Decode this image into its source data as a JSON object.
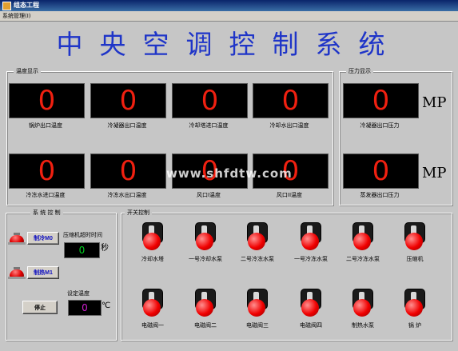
{
  "window": {
    "title": "组态工程"
  },
  "menu": {
    "items": [
      "系统管理(I)"
    ]
  },
  "main_title": "中央空调控制系统",
  "temperature_panel": {
    "title": "温度显示",
    "displays": [
      {
        "value": "0",
        "label": "锅炉出口温度"
      },
      {
        "value": "0",
        "label": "冷凝器出口温度"
      },
      {
        "value": "0",
        "label": "冷却塔进口温度"
      },
      {
        "value": "0",
        "label": "冷却水出口温度"
      },
      {
        "value": "0",
        "label": "冷冻水进口温度"
      },
      {
        "value": "0",
        "label": "冷冻水出口温度"
      },
      {
        "value": "0",
        "label": "风口I温度"
      },
      {
        "value": "0",
        "label": "风口II温度"
      }
    ]
  },
  "pressure_panel": {
    "title": "压力显示",
    "displays": [
      {
        "value": "0",
        "label": "冷凝器出口压力",
        "unit": "MP"
      },
      {
        "value": "0",
        "label": "蒸发器出口压力",
        "unit": "MP"
      }
    ]
  },
  "system_control": {
    "title": "系 统 控 制",
    "cool_button": "制冷M0",
    "heat_button": "制热M1",
    "stop_button": "停止",
    "timeout_label": "压缩机超时时间",
    "timeout_value": "0",
    "timeout_unit": "秒",
    "set_temp_label": "设定温度",
    "set_temp_value": "0",
    "set_temp_unit": "℃"
  },
  "switch_panel": {
    "title": "开关控制",
    "switches": [
      {
        "label": "冷却水塔"
      },
      {
        "label": "一号冷却水泵"
      },
      {
        "label": "二号冷冻水泵"
      },
      {
        "label": "一号冷冻水泵"
      },
      {
        "label": "二号冷冻水泵"
      },
      {
        "label": "压缩机"
      },
      {
        "label": "电磁阀一"
      },
      {
        "label": "电磁阀二"
      },
      {
        "label": "电磁阀三"
      },
      {
        "label": "电磁阀四"
      },
      {
        "label": "制热水泵"
      },
      {
        "label": "锅 炉"
      }
    ]
  },
  "watermark": "www.shfdtw.com"
}
